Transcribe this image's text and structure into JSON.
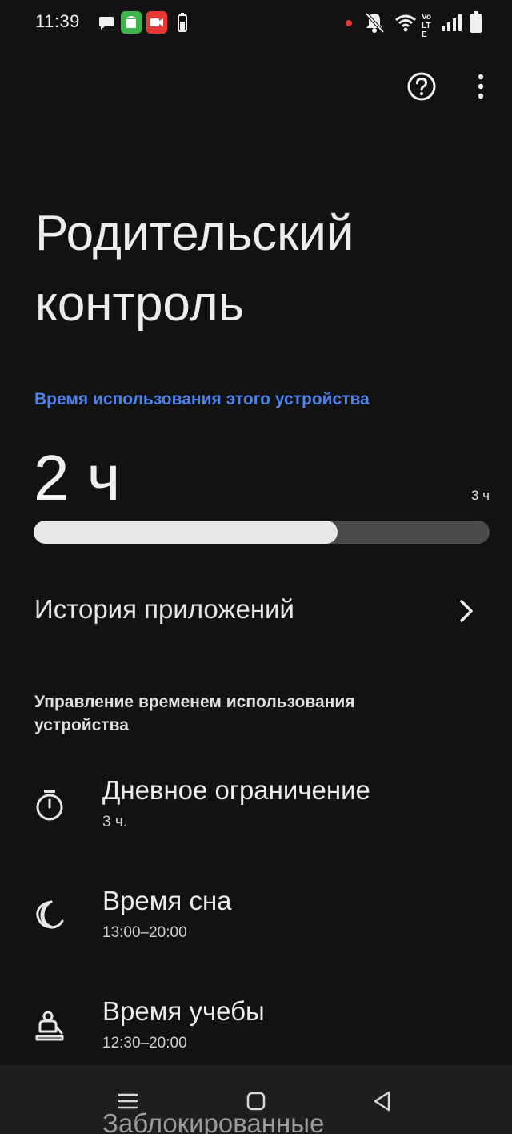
{
  "status_bar": {
    "time": "11:39",
    "left_icons": [
      "chat-bubble-icon",
      "android-app-icon",
      "screen-record-icon",
      "battery-small-icon"
    ],
    "right_icons": [
      "notification-dot-icon",
      "mute-bell-icon",
      "wifi-icon",
      "volte-icon",
      "signal-icon",
      "battery-icon"
    ],
    "volte_label": "Vo LTE",
    "colors": {
      "green_badge": "#3cb54a",
      "red_badge": "#e53935",
      "dot": "#e53935"
    }
  },
  "top_actions": {
    "help_icon": "help-circle-icon",
    "more_icon": "more-vertical-icon"
  },
  "page": {
    "title": "Родительский контроль"
  },
  "usage": {
    "label": "Время использования этого устройства",
    "value": "2 ч",
    "limit": "3 ч",
    "progress": 0.667,
    "accent": "#4f82e8"
  },
  "history": {
    "label": "История приложений",
    "icon": "chevron-right-icon"
  },
  "management": {
    "header": "Управление временем использования устройства",
    "items": [
      {
        "title": "Дневное ограничение",
        "subtitle": "3 ч.",
        "icon": "timer-icon"
      },
      {
        "title": "Время сна",
        "subtitle": "13:00–20:00",
        "icon": "moon-icon"
      },
      {
        "title": "Время учебы",
        "subtitle": "12:30–20:00",
        "icon": "school-icon"
      }
    ],
    "next_peek": "Заблокированные"
  },
  "nav_bar": {
    "icons": [
      "menu-icon",
      "home-icon",
      "back-icon"
    ]
  }
}
